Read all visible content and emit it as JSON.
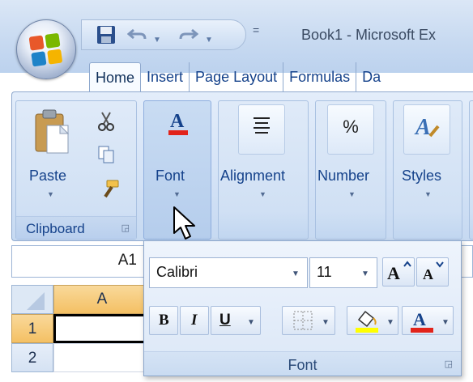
{
  "window": {
    "title": "Book1 - Microsoft Ex"
  },
  "quick_access": {
    "more": "="
  },
  "tabs": [
    {
      "label": "Home"
    },
    {
      "label": "Insert"
    },
    {
      "label": "Page Layout"
    },
    {
      "label": "Formulas"
    },
    {
      "label": "Da"
    }
  ],
  "ribbon": {
    "clipboard": {
      "label": "Clipboard",
      "paste": "Paste"
    },
    "font": {
      "label": "Font"
    },
    "alignment": {
      "label": "Alignment"
    },
    "number": {
      "label": "Number",
      "glyph": "%"
    },
    "styles": {
      "label": "Styles"
    }
  },
  "formula_bar": {
    "name_box": "A1"
  },
  "grid": {
    "columns": [
      "A"
    ],
    "rows": [
      "1",
      "2"
    ]
  },
  "font_popup": {
    "font_name": "Calibri",
    "font_size": "11",
    "bold": "B",
    "italic": "I",
    "underline": "U",
    "label": "Font"
  },
  "colors": {
    "accent": "#15428b",
    "font_color": "#e2231a",
    "highlight": "#ffff00"
  }
}
